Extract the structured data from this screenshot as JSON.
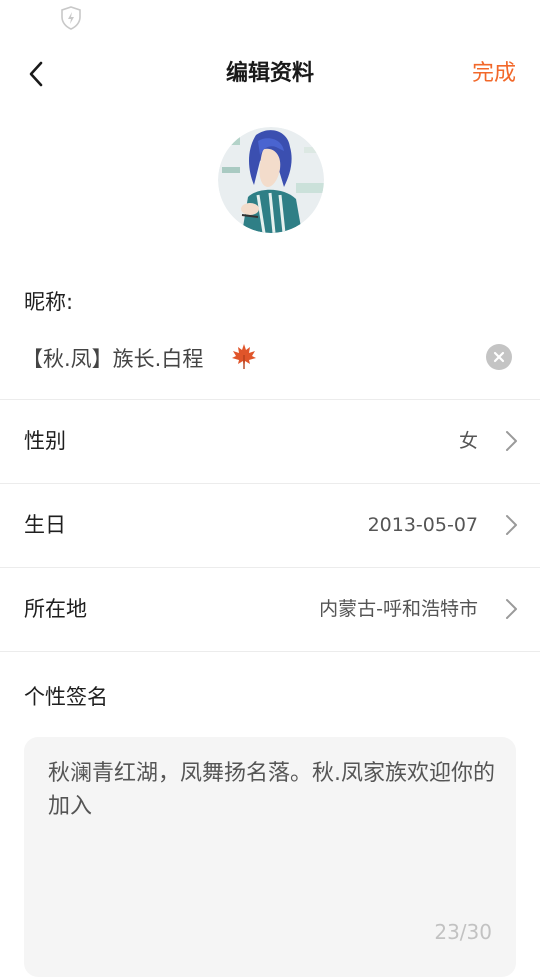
{
  "header": {
    "title": "编辑资料",
    "back_icon": "chevron-left-icon",
    "done_label": "完成"
  },
  "colors": {
    "accent": "#f2682a",
    "divider": "#ececec",
    "bio_background": "#f5f5f5",
    "muted_text": "#c2c2c2"
  },
  "profile": {
    "nickname_label": "昵称:",
    "nickname_value": "【秋.凤】族长.白程",
    "nickname_decoration_icon": "maple-leaf-icon",
    "clear_icon": "clear-circle-icon"
  },
  "fields": [
    {
      "label": "性别",
      "value": "女",
      "icon": "chevron-right-icon"
    },
    {
      "label": "生日",
      "value": "2013-05-07",
      "icon": "chevron-right-icon"
    },
    {
      "label": "所在地",
      "value": "内蒙古-呼和浩特市",
      "icon": "chevron-right-icon"
    }
  ],
  "bio": {
    "label": "个性签名",
    "text": "秋澜青红湖，凤舞扬名落。秋.凤家族欢迎你的加入",
    "counter": "23/30"
  }
}
